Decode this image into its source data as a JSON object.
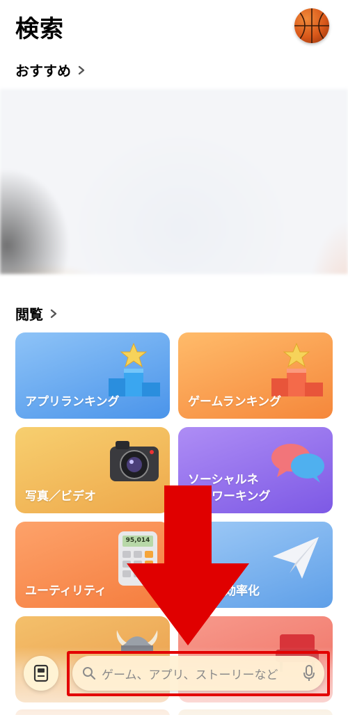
{
  "header": {
    "title": "検索"
  },
  "recommended": {
    "label": "おすすめ"
  },
  "browse": {
    "label": "閲覧",
    "tiles": [
      {
        "label": "アプリランキング"
      },
      {
        "label": "ゲームランキング"
      },
      {
        "label": "写真／ビデオ"
      },
      {
        "label": "ソーシャルネ\nットワーキング"
      },
      {
        "label": "ユーティリティ"
      },
      {
        "label": "効率化"
      },
      {
        "label": ""
      },
      {
        "label": ""
      }
    ]
  },
  "calculator_display": "95,014",
  "search": {
    "placeholder": "ゲーム、アプリ、ストーリーなど"
  },
  "annotation": {
    "arrow_color": "#e00000",
    "box_color": "#e30000"
  }
}
